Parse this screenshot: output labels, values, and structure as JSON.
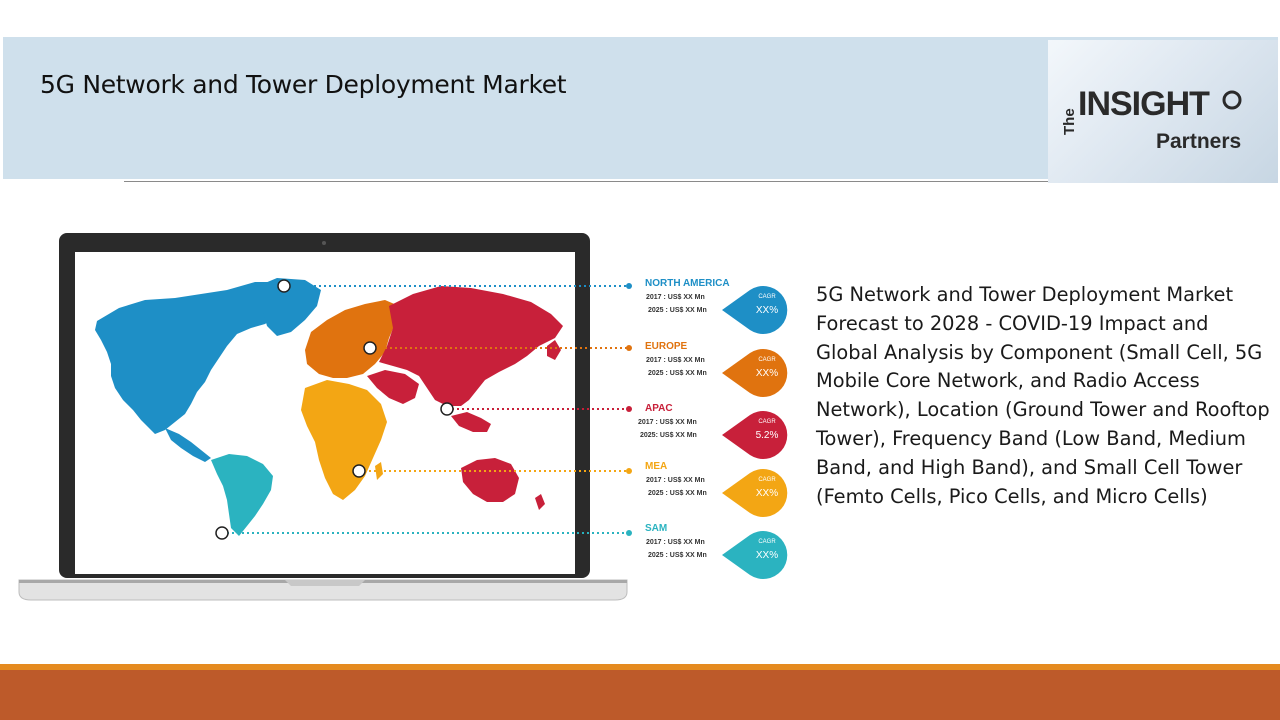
{
  "header": {
    "title": "5G Network and Tower Deployment Market"
  },
  "logo": {
    "line1": "The",
    "line2": "INSIGHT",
    "line3": "Partners"
  },
  "description": "5G Network and Tower Deployment Market Forecast to 2028 - COVID-19 Impact and Global Analysis by Component (Small Cell, 5G Mobile Core Network, and Radio Access Network), Location (Ground Tower and Rooftop Tower), Frequency Band (Low Band, Medium Band, and High Band), and Small Cell Tower (Femto Cells, Pico Cells, and Micro Cells)",
  "regions": [
    {
      "name": "NORTH AMERICA",
      "v2017": "2017 : US$ XX Mn",
      "v2025": "2025 : US$ XX Mn",
      "cagr_label": "CAGR",
      "cagr": "XX%",
      "color": "#1e8fc6"
    },
    {
      "name": "EUROPE",
      "v2017": "2017 : US$ XX  Mn",
      "v2025": "2025 : US$ XX Mn",
      "cagr_label": "CAGR",
      "cagr": "XX%",
      "color": "#e0730f"
    },
    {
      "name": "APAC",
      "v2017": "2017 : US$ XX Mn",
      "v2025": "2025:  US$ XX Mn",
      "cagr_label": "CAGR",
      "cagr": "5.2%",
      "color": "#c8203a"
    },
    {
      "name": "MEA",
      "v2017": "2017 : US$ XX Mn",
      "v2025": "2025 : US$ XX Mn",
      "cagr_label": "CAGR",
      "cagr": "XX%",
      "color": "#f3a614"
    },
    {
      "name": "SAM",
      "v2017": "2017 : US$  XX  Mn",
      "v2025": "2025 : US$  XX  Mn",
      "cagr_label": "CAGR",
      "cagr": "XX%",
      "color": "#2bb3c0"
    }
  ],
  "map_colors": {
    "north_america": "#1e8fc6",
    "south_america": "#2bb3c0",
    "europe": "#e0730f",
    "asia": "#c8203a",
    "africa": "#f3a614",
    "oceania": "#c8203a"
  },
  "icons": {
    "pin": "map-pin-icon",
    "marker": "location-marker-icon"
  },
  "colors": {
    "header_bg": "#cfe0ec",
    "footer_bar": "#bd5a2a",
    "footer_line": "#e58a1f"
  }
}
